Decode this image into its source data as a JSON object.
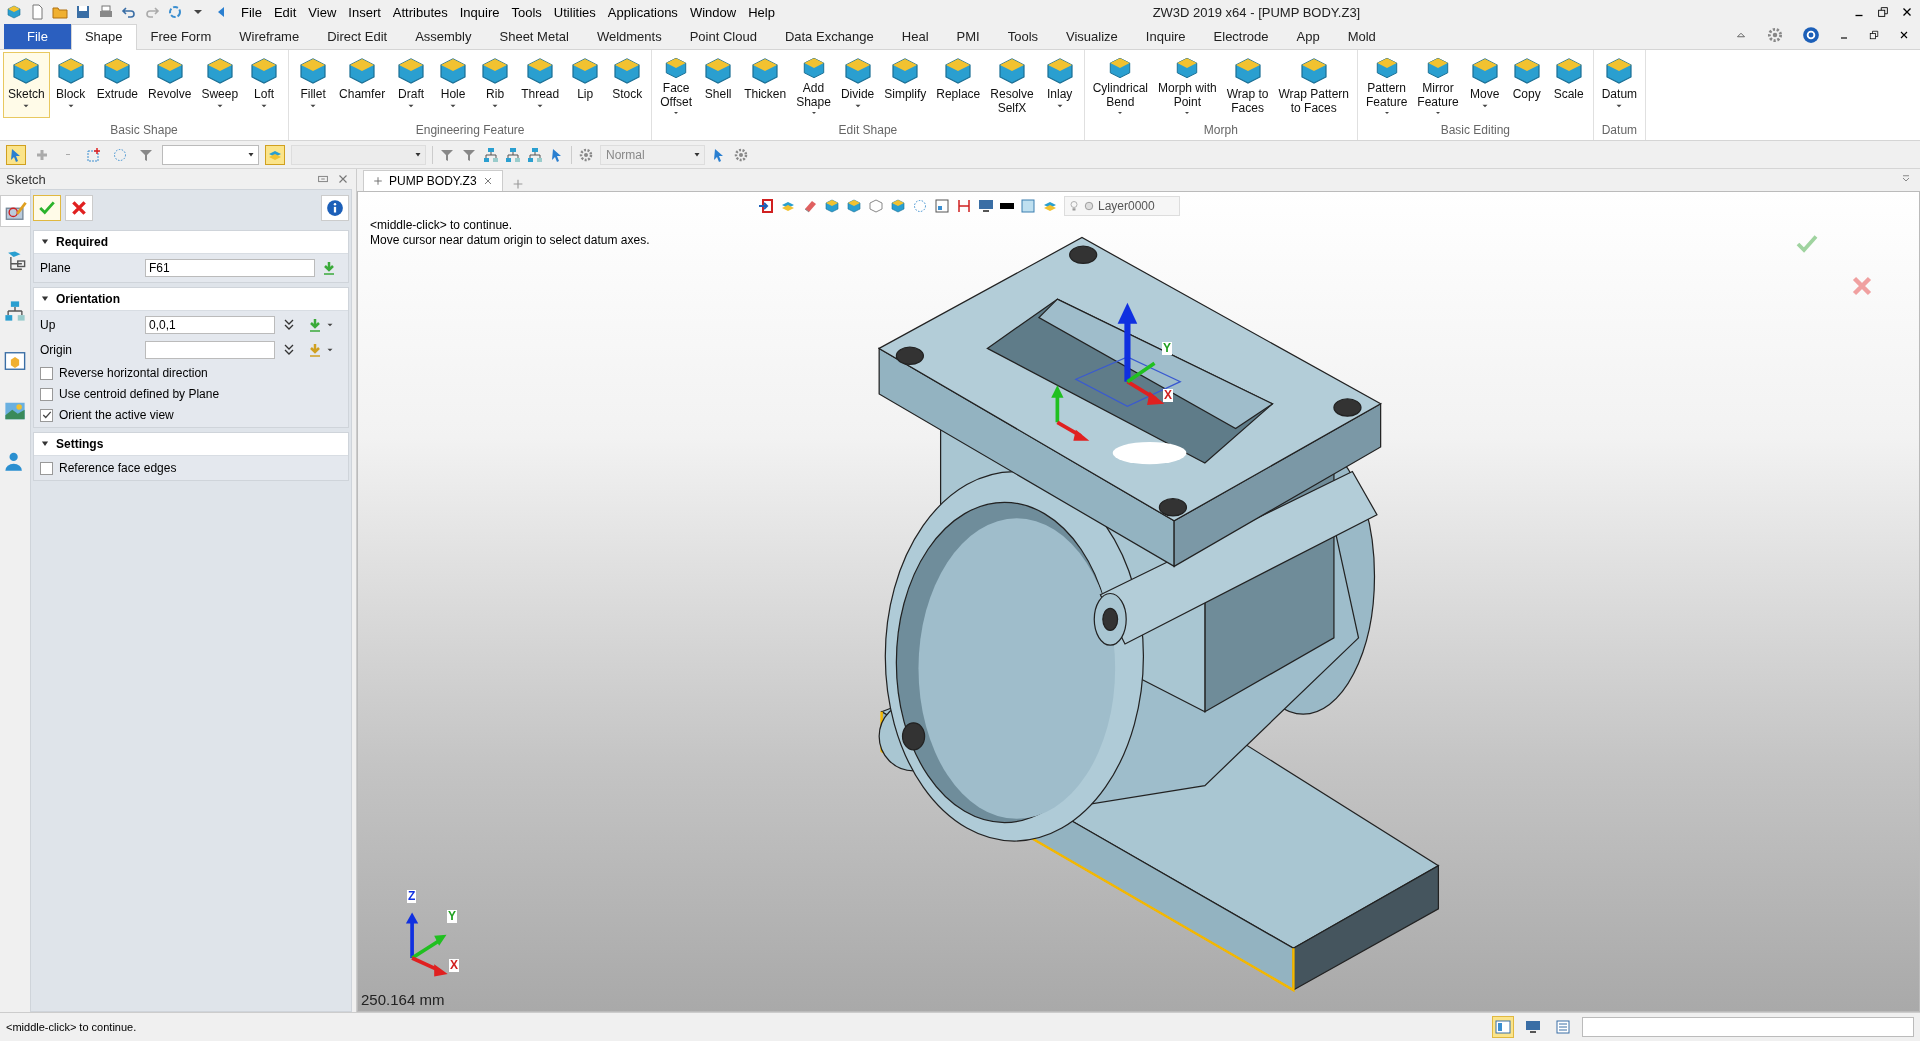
{
  "window": {
    "title": "ZW3D 2019  x64 - [PUMP BODY.Z3]"
  },
  "menu": [
    "File",
    "Edit",
    "View",
    "Insert",
    "Attributes",
    "Inquire",
    "Tools",
    "Utilities",
    "Applications",
    "Window",
    "Help"
  ],
  "ribbon_tabs": [
    {
      "label": "File",
      "kind": "file",
      "selected": false
    },
    {
      "label": "Shape",
      "kind": "tab",
      "selected": true
    },
    {
      "label": "Free Form",
      "kind": "tab",
      "selected": false
    },
    {
      "label": "Wireframe",
      "kind": "tab",
      "selected": false
    },
    {
      "label": "Direct Edit",
      "kind": "tab",
      "selected": false
    },
    {
      "label": "Assembly",
      "kind": "tab",
      "selected": false
    },
    {
      "label": "Sheet Metal",
      "kind": "tab",
      "selected": false
    },
    {
      "label": "Weldments",
      "kind": "tab",
      "selected": false
    },
    {
      "label": "Point Cloud",
      "kind": "tab",
      "selected": false
    },
    {
      "label": "Data Exchange",
      "kind": "tab",
      "selected": false
    },
    {
      "label": "Heal",
      "kind": "tab",
      "selected": false
    },
    {
      "label": "PMI",
      "kind": "tab",
      "selected": false
    },
    {
      "label": "Tools",
      "kind": "tab",
      "selected": false
    },
    {
      "label": "Visualize",
      "kind": "tab",
      "selected": false
    },
    {
      "label": "Inquire",
      "kind": "tab",
      "selected": false
    },
    {
      "label": "Electrode",
      "kind": "tab",
      "selected": false
    },
    {
      "label": "App",
      "kind": "tab",
      "selected": false
    },
    {
      "label": "Mold",
      "kind": "tab",
      "selected": false
    }
  ],
  "ribbon_groups": [
    {
      "label": "Basic Shape",
      "buttons": [
        {
          "lines": [
            "Sketch"
          ],
          "dropdown": true,
          "active": true
        },
        {
          "lines": [
            "Block"
          ],
          "dropdown": true,
          "active": false
        },
        {
          "lines": [
            "Extrude"
          ],
          "dropdown": false,
          "active": false
        },
        {
          "lines": [
            "Revolve"
          ],
          "dropdown": false,
          "active": false
        },
        {
          "lines": [
            "Sweep"
          ],
          "dropdown": true,
          "active": false
        },
        {
          "lines": [
            "Loft"
          ],
          "dropdown": true,
          "active": false
        }
      ]
    },
    {
      "label": "Engineering Feature",
      "buttons": [
        {
          "lines": [
            "Fillet"
          ],
          "dropdown": true,
          "active": false
        },
        {
          "lines": [
            "Chamfer"
          ],
          "dropdown": false,
          "active": false
        },
        {
          "lines": [
            "Draft"
          ],
          "dropdown": true,
          "active": false
        },
        {
          "lines": [
            "Hole"
          ],
          "dropdown": true,
          "active": false
        },
        {
          "lines": [
            "Rib"
          ],
          "dropdown": true,
          "active": false
        },
        {
          "lines": [
            "Thread"
          ],
          "dropdown": true,
          "active": false
        },
        {
          "lines": [
            "Lip"
          ],
          "dropdown": false,
          "active": false
        },
        {
          "lines": [
            "Stock"
          ],
          "dropdown": false,
          "active": false
        }
      ]
    },
    {
      "label": "Edit Shape",
      "buttons": [
        {
          "lines": [
            "Face",
            "Offset"
          ],
          "dropdown": true,
          "active": false
        },
        {
          "lines": [
            "Shell"
          ],
          "dropdown": false,
          "active": false
        },
        {
          "lines": [
            "Thicken"
          ],
          "dropdown": false,
          "active": false
        },
        {
          "lines": [
            "Add",
            "Shape"
          ],
          "dropdown": true,
          "active": false
        },
        {
          "lines": [
            "Divide"
          ],
          "dropdown": true,
          "active": false
        },
        {
          "lines": [
            "Simplify"
          ],
          "dropdown": false,
          "active": false
        },
        {
          "lines": [
            "Replace"
          ],
          "dropdown": false,
          "active": false
        },
        {
          "lines": [
            "Resolve",
            "SelfX"
          ],
          "dropdown": false,
          "active": false
        },
        {
          "lines": [
            "Inlay"
          ],
          "dropdown": true,
          "active": false
        }
      ]
    },
    {
      "label": "Morph",
      "buttons": [
        {
          "lines": [
            "Cylindrical",
            "Bend"
          ],
          "dropdown": true,
          "active": false
        },
        {
          "lines": [
            "Morph with",
            "Point"
          ],
          "dropdown": true,
          "active": false
        },
        {
          "lines": [
            "Wrap to",
            "Faces"
          ],
          "dropdown": false,
          "active": false
        },
        {
          "lines": [
            "Wrap Pattern",
            "to Faces"
          ],
          "dropdown": false,
          "active": false
        }
      ]
    },
    {
      "label": "Basic Editing",
      "buttons": [
        {
          "lines": [
            "Pattern",
            "Feature"
          ],
          "dropdown": true,
          "active": false
        },
        {
          "lines": [
            "Mirror",
            "Feature"
          ],
          "dropdown": true,
          "active": false
        },
        {
          "lines": [
            "Move"
          ],
          "dropdown": true,
          "active": false
        },
        {
          "lines": [
            "Copy"
          ],
          "dropdown": false,
          "active": false
        },
        {
          "lines": [
            "Scale"
          ],
          "dropdown": false,
          "active": false
        }
      ]
    },
    {
      "label": "Datum",
      "buttons": [
        {
          "lines": [
            "Datum"
          ],
          "dropdown": true,
          "active": false
        }
      ]
    }
  ],
  "toolbar": {
    "tools": [
      {
        "kind": "select",
        "active": true
      },
      {
        "kind": "add",
        "active": false
      },
      {
        "kind": "remove",
        "active": false
      },
      {
        "kind": "box-select",
        "active": false
      },
      {
        "kind": "lasso",
        "active": false
      },
      {
        "kind": "filter",
        "active": false
      },
      {
        "kind": "combo"
      },
      {
        "kind": "pick-mode",
        "active": true
      },
      {
        "kind": "combo-disabled"
      }
    ],
    "view_mode": "Normal"
  },
  "panel": {
    "title": "Sketch",
    "side_tabs": [
      {
        "kind": "sketch",
        "selected": true
      },
      {
        "kind": "history",
        "selected": false
      },
      {
        "kind": "assembly",
        "selected": false
      },
      {
        "kind": "view",
        "selected": false
      },
      {
        "kind": "scene",
        "selected": false
      },
      {
        "kind": "user",
        "selected": false
      }
    ],
    "sections": [
      {
        "title": "Required",
        "expanded": true,
        "fields": [
          {
            "label": "Plane",
            "value": "F61",
            "kind": "plane"
          }
        ]
      },
      {
        "title": "Orientation",
        "expanded": true,
        "fields": [
          {
            "label": "Up",
            "value": "0,0,1",
            "kind": "vector"
          },
          {
            "label": "Origin",
            "kind": "point"
          }
        ],
        "options": [
          {
            "label": "Reverse horizontal direction",
            "checked": false
          },
          {
            "label": "Use centroid defined by Plane",
            "checked": false
          },
          {
            "label": "Orient the active view",
            "checked": true
          }
        ]
      },
      {
        "title": "Settings",
        "expanded": true,
        "options": [
          {
            "label": "Reference face edges",
            "checked": false
          }
        ]
      }
    ]
  },
  "document_tabs": [
    {
      "label": "PUMP BODY.Z3",
      "selected": true
    }
  ],
  "viewport": {
    "layer": "Layer0000",
    "prompt": [
      "<middle-click> to continue.",
      "Move cursor near datum origin to select datum axes."
    ],
    "model_axes": [
      "Y",
      "X"
    ],
    "corner_axes": [
      "Z",
      "Y",
      "X"
    ],
    "scale": "250.164 mm"
  },
  "status_bar": {
    "message": "<middle-click> to continue.",
    "modes": [
      {
        "kind": "layout",
        "selected": true
      },
      {
        "kind": "screen",
        "selected": false
      },
      {
        "kind": "list",
        "selected": false
      }
    ]
  }
}
